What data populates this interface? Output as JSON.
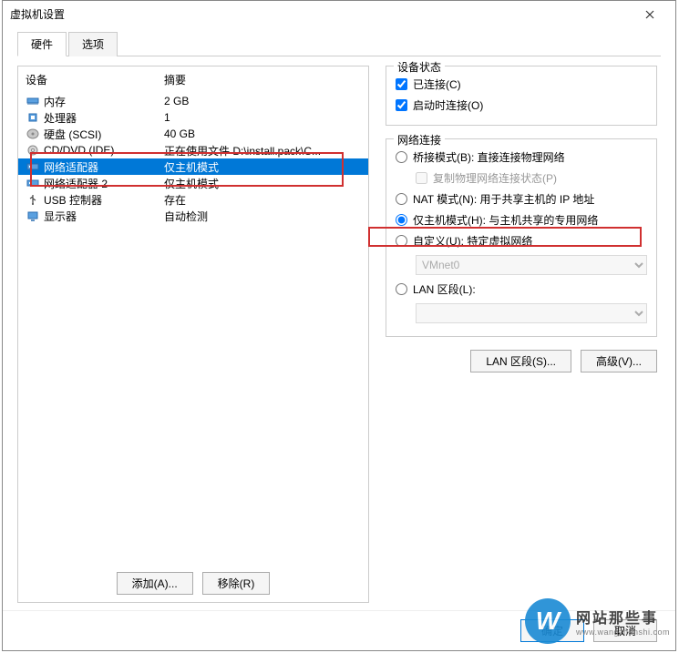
{
  "window": {
    "title": "虚拟机设置"
  },
  "tabs": {
    "hardware": "硬件",
    "options": "选项"
  },
  "headers": {
    "device": "设备",
    "summary": "摘要"
  },
  "devices": [
    {
      "icon": "memory-icon",
      "label": "内存",
      "summary": "2 GB",
      "selected": false
    },
    {
      "icon": "cpu-icon",
      "label": "处理器",
      "summary": "1",
      "selected": false
    },
    {
      "icon": "disk-icon",
      "label": "硬盘 (SCSI)",
      "summary": "40 GB",
      "selected": false
    },
    {
      "icon": "cd-icon",
      "label": "CD/DVD (IDE)",
      "summary": "正在使用文件 D:\\install.pack\\C...",
      "selected": false
    },
    {
      "icon": "nic-icon",
      "label": "网络适配器",
      "summary": "仅主机模式",
      "selected": true
    },
    {
      "icon": "nic-icon",
      "label": "网络适配器 2",
      "summary": "仅主机模式",
      "selected": false
    },
    {
      "icon": "usb-icon",
      "label": "USB 控制器",
      "summary": "存在",
      "selected": false
    },
    {
      "icon": "display-icon",
      "label": "显示器",
      "summary": "自动检测",
      "selected": false
    }
  ],
  "left_buttons": {
    "add": "添加(A)...",
    "remove": "移除(R)"
  },
  "device_status": {
    "legend": "设备状态",
    "connected": "已连接(C)",
    "connect_at_power_on": "启动时连接(O)"
  },
  "network": {
    "legend": "网络连接",
    "bridged": "桥接模式(B): 直接连接物理网络",
    "replicate": "复制物理网络连接状态(P)",
    "nat": "NAT 模式(N): 用于共享主机的 IP 地址",
    "hostonly": "仅主机模式(H): 与主机共享的专用网络",
    "custom": "自定义(U): 特定虚拟网络",
    "vmnet": "VMnet0",
    "lan_segment": "LAN 区段(L):",
    "lan_value": ""
  },
  "right_buttons": {
    "lan_segments": "LAN 区段(S)...",
    "advanced": "高级(V)..."
  },
  "footer": {
    "ok": "确定",
    "cancel": "取消"
  },
  "watermark": {
    "letter": "W",
    "cn": "网站那些事",
    "en": "www.wangzhanshi.com"
  }
}
